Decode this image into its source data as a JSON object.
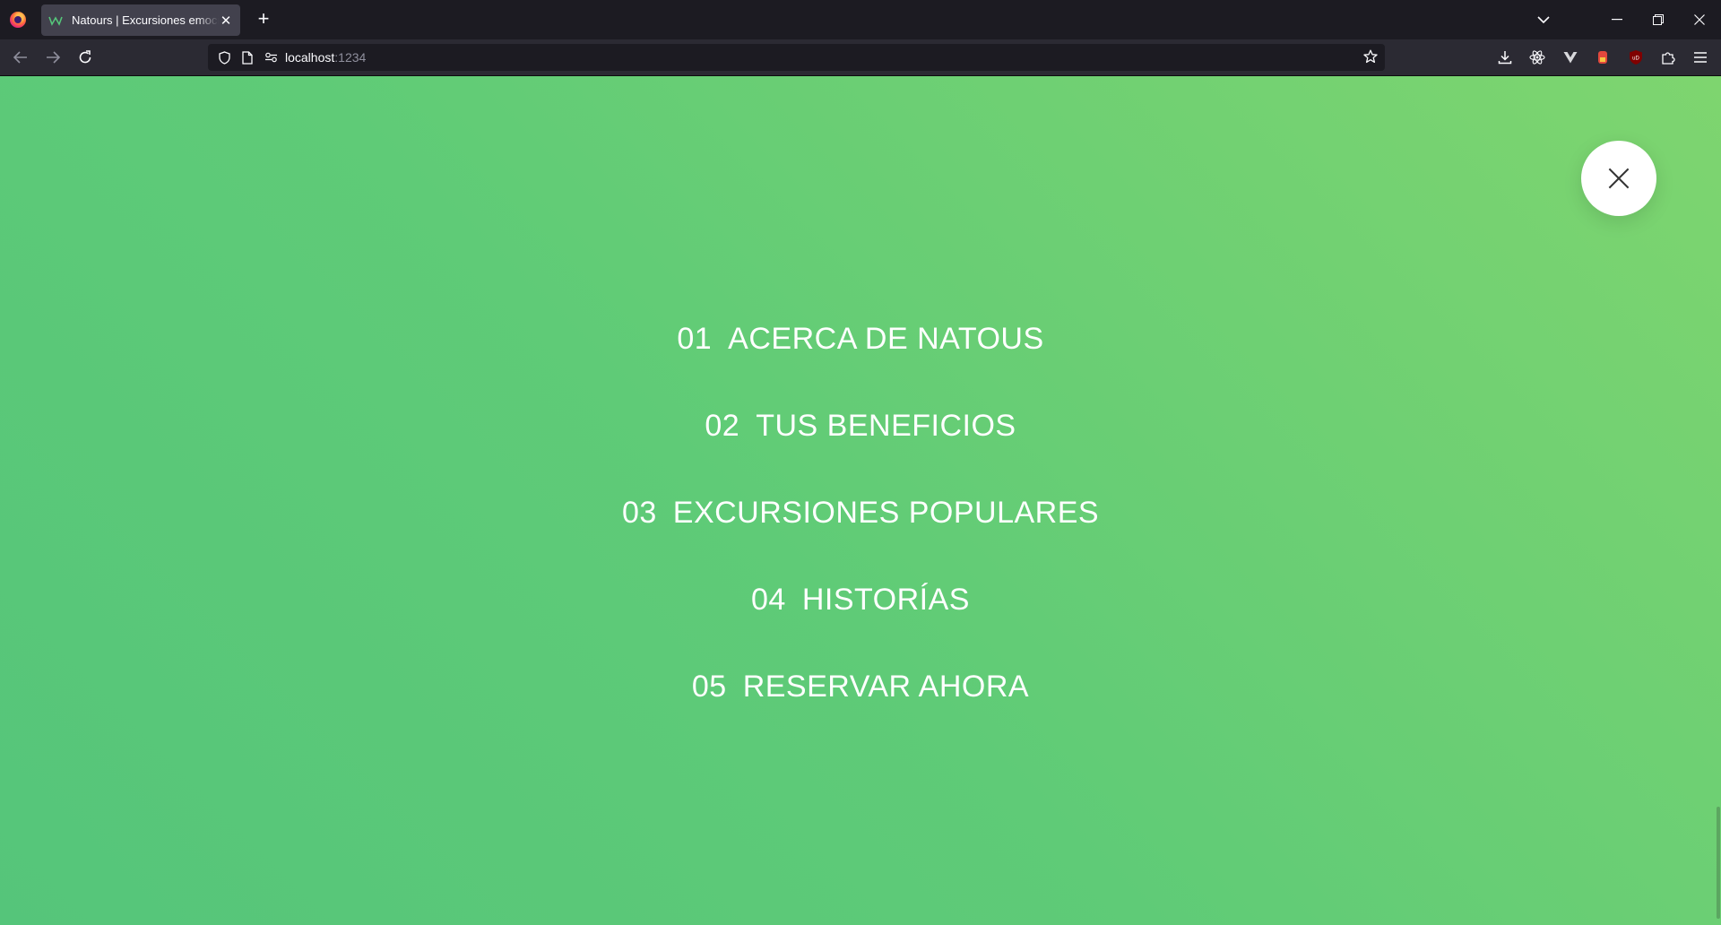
{
  "browser": {
    "tab_title": "Natours | Excursiones emocionantes",
    "tab_favicon": "natours-logo-icon",
    "url_host": "localhost",
    "url_port": ":1234",
    "icons": [
      "back-icon",
      "forward-icon",
      "reload-icon",
      "shield-icon",
      "page-icon",
      "permissions-icon",
      "star-icon",
      "download-icon",
      "react-devtools-icon",
      "vue-devtools-icon",
      "extension-icon",
      "ublock-icon",
      "extensions-icon",
      "menu-icon"
    ]
  },
  "page": {
    "background_colors": [
      "#7ed56f",
      "#55c57a"
    ],
    "close_button_icon": "close-icon",
    "nav": [
      {
        "num": "01",
        "label": "Acerca de Natous"
      },
      {
        "num": "02",
        "label": "Tus beneficios"
      },
      {
        "num": "03",
        "label": "Excursiones populares"
      },
      {
        "num": "04",
        "label": "Historías"
      },
      {
        "num": "05",
        "label": "Reservar ahora"
      }
    ]
  }
}
